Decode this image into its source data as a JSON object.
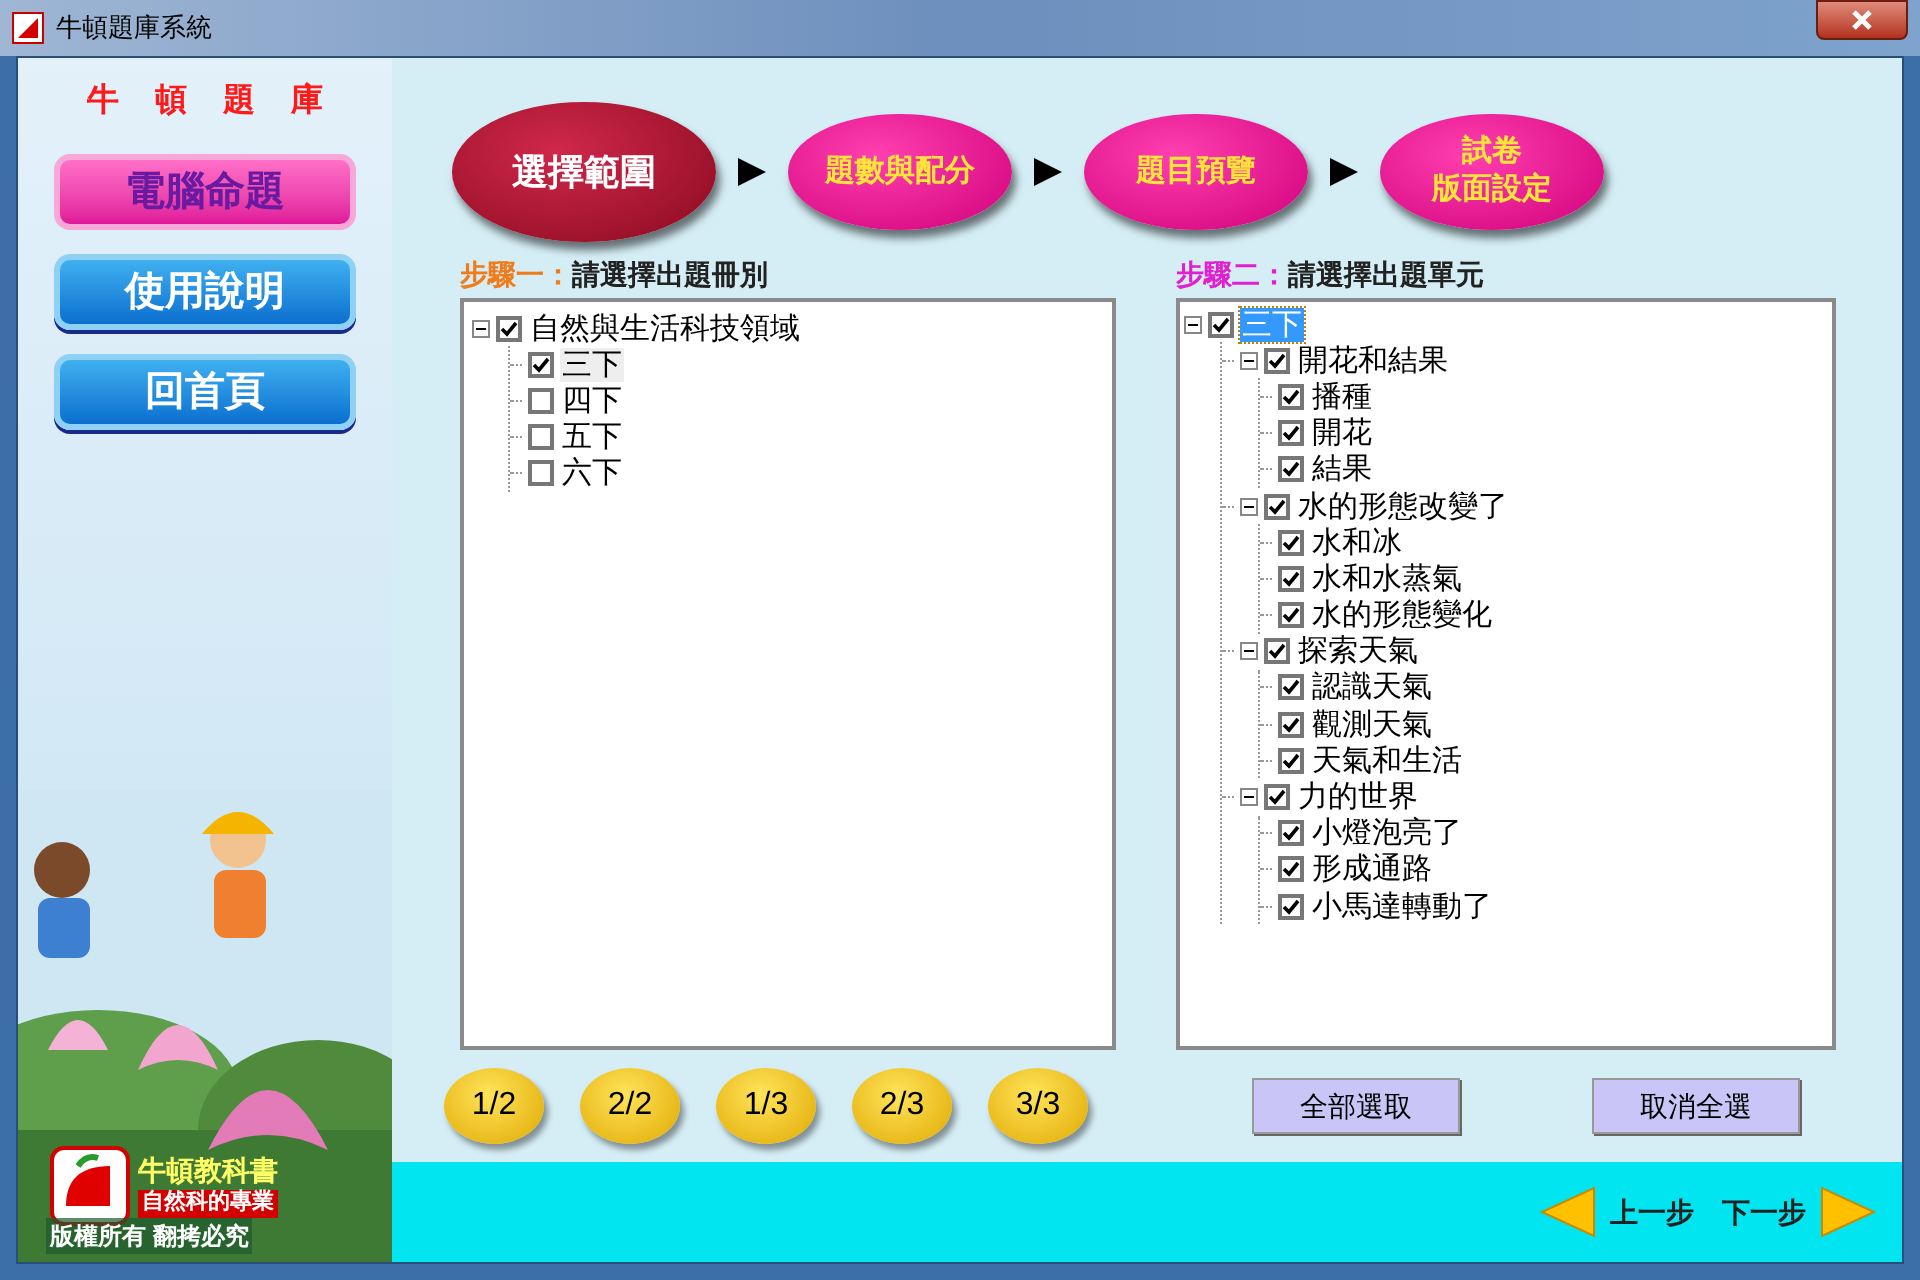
{
  "window": {
    "title": "牛頓題庫系統"
  },
  "sidebar": {
    "brand": "牛頓題庫",
    "items": [
      {
        "label": "電腦命題",
        "selected": true
      },
      {
        "label": "使用說明",
        "selected": false
      },
      {
        "label": "回首頁",
        "selected": false
      }
    ],
    "logo": {
      "name": "牛頓教科書",
      "slogan": "自然科的專業"
    },
    "copyright": "版權所有 翻拷必究"
  },
  "steps": [
    {
      "lines": [
        "選擇範圍"
      ],
      "selected": true
    },
    {
      "lines": [
        "題數與配分"
      ],
      "selected": false
    },
    {
      "lines": [
        "題目預覽"
      ],
      "selected": false
    },
    {
      "lines": [
        "試卷",
        "版面設定"
      ],
      "selected": false
    }
  ],
  "step_one": {
    "prefix": "步驟一：",
    "title": "請選擇出題冊別",
    "focused": false,
    "tree": [
      {
        "label": "自然與生活科技領域",
        "checked": true,
        "expanded": true,
        "selected": false,
        "children": [
          {
            "label": "三下",
            "checked": true,
            "selected": true
          },
          {
            "label": "四下",
            "checked": false,
            "selected": false
          },
          {
            "label": "五下",
            "checked": false,
            "selected": false
          },
          {
            "label": "六下",
            "checked": false,
            "selected": false
          }
        ]
      }
    ]
  },
  "step_two": {
    "prefix": "步驟二：",
    "title": "請選擇出題單元",
    "focused": true,
    "tree": [
      {
        "label": "三下",
        "checked": true,
        "expanded": true,
        "selected": true,
        "children": [
          {
            "label": "開花和結果",
            "checked": true,
            "expanded": true,
            "selected": false,
            "children": [
              {
                "label": "播種",
                "checked": true,
                "selected": false
              },
              {
                "label": "開花",
                "checked": true,
                "selected": false
              },
              {
                "label": "結果",
                "checked": true,
                "selected": false
              }
            ]
          },
          {
            "label": "水的形態改變了",
            "checked": true,
            "expanded": true,
            "selected": false,
            "children": [
              {
                "label": "水和冰",
                "checked": true,
                "selected": false
              },
              {
                "label": "水和水蒸氣",
                "checked": true,
                "selected": false
              },
              {
                "label": "水的形態變化",
                "checked": true,
                "selected": false
              }
            ]
          },
          {
            "label": "探索天氣",
            "checked": true,
            "expanded": true,
            "selected": false,
            "children": [
              {
                "label": "認識天氣",
                "checked": true,
                "selected": false
              },
              {
                "label": "觀測天氣",
                "checked": true,
                "selected": false
              },
              {
                "label": "天氣和生活",
                "checked": true,
                "selected": false
              }
            ]
          },
          {
            "label": "力的世界",
            "checked": true,
            "expanded": true,
            "selected": false,
            "children": [
              {
                "label": "小燈泡亮了",
                "checked": true,
                "selected": false
              },
              {
                "label": "形成通路",
                "checked": true,
                "selected": false
              },
              {
                "label": "小馬達轉動了",
                "checked": true,
                "selected": false
              }
            ]
          }
        ]
      }
    ]
  },
  "pages": [
    "1/2",
    "2/2",
    "1/3",
    "2/3",
    "3/3"
  ],
  "buttons": [
    "全部選取",
    "取消全選"
  ],
  "nav": {
    "previous": "上一步",
    "next": "下一步"
  }
}
